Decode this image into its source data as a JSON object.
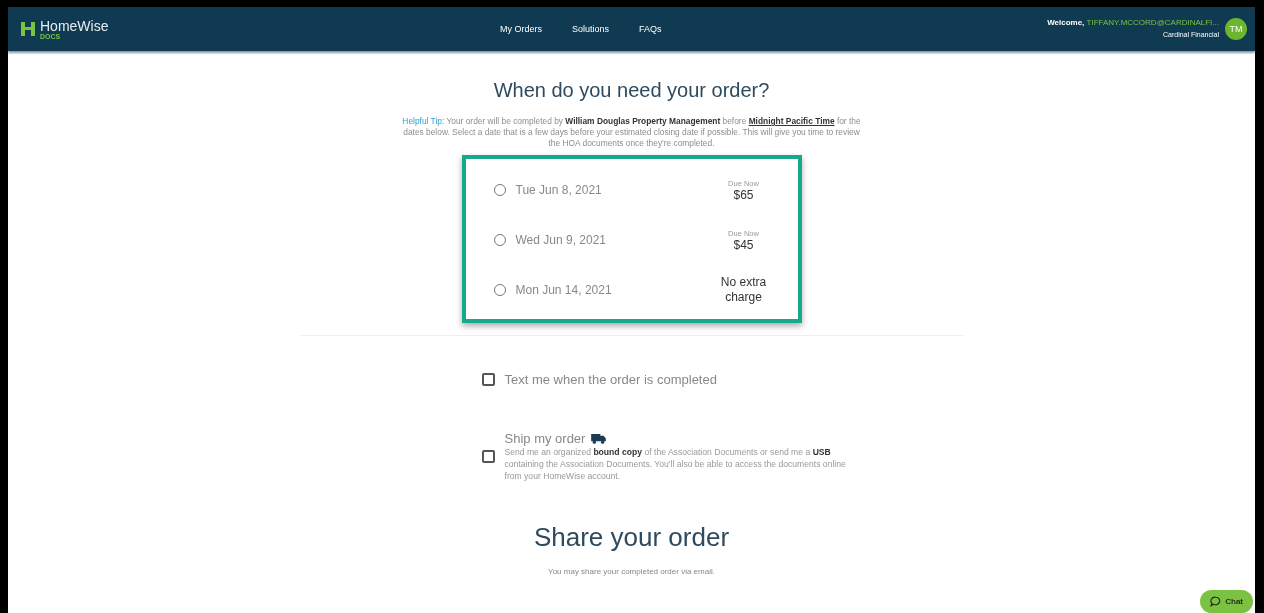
{
  "header": {
    "logo": "HomeWise",
    "logo_sub": "DOCS",
    "nav": [
      {
        "label": "My Orders"
      },
      {
        "label": "Solutions"
      },
      {
        "label": "FAQs"
      }
    ],
    "welcome": "Welcome,",
    "user": "TIFFANY.MCCORD@CARDINALFI...",
    "company": "Cardinal Financial",
    "avatar": "TM"
  },
  "title": "When do you need your order?",
  "tip_label": "Helpful Tip:",
  "tip": " Your order will be completed by **William Douglas Property Management** before **Midnight Pacific Time** for the dates below. Select a date that is a few days before your estimated closing date if possible. This will give you time to review the HOA documents once they're completed.",
  "delivery_options": [
    {
      "date": "Tue Jun 8, 2021",
      "selected": false,
      "caption": "Due Now",
      "price": "$65"
    },
    {
      "date": "Wed Jun 9, 2021",
      "selected": false,
      "caption": "Due Now",
      "price": "$45"
    },
    {
      "date": "Mon Jun 14, 2021",
      "selected": false,
      "price": "No extra charge"
    }
  ],
  "text_me": {
    "label": "Text me when the order is completed",
    "checked": false
  },
  "ship": {
    "label": "Ship my order",
    "description": "Send me an organized **bound copy** of the Association Documents or send me a **USB** containing the Association Documents. You'll also be able to access the documents online from your HomeWise account.",
    "checked": false
  },
  "share_title": "Share your order",
  "share_subtitle": "You may share your completed order via email.",
  "chat": {
    "label": "Chat"
  }
}
